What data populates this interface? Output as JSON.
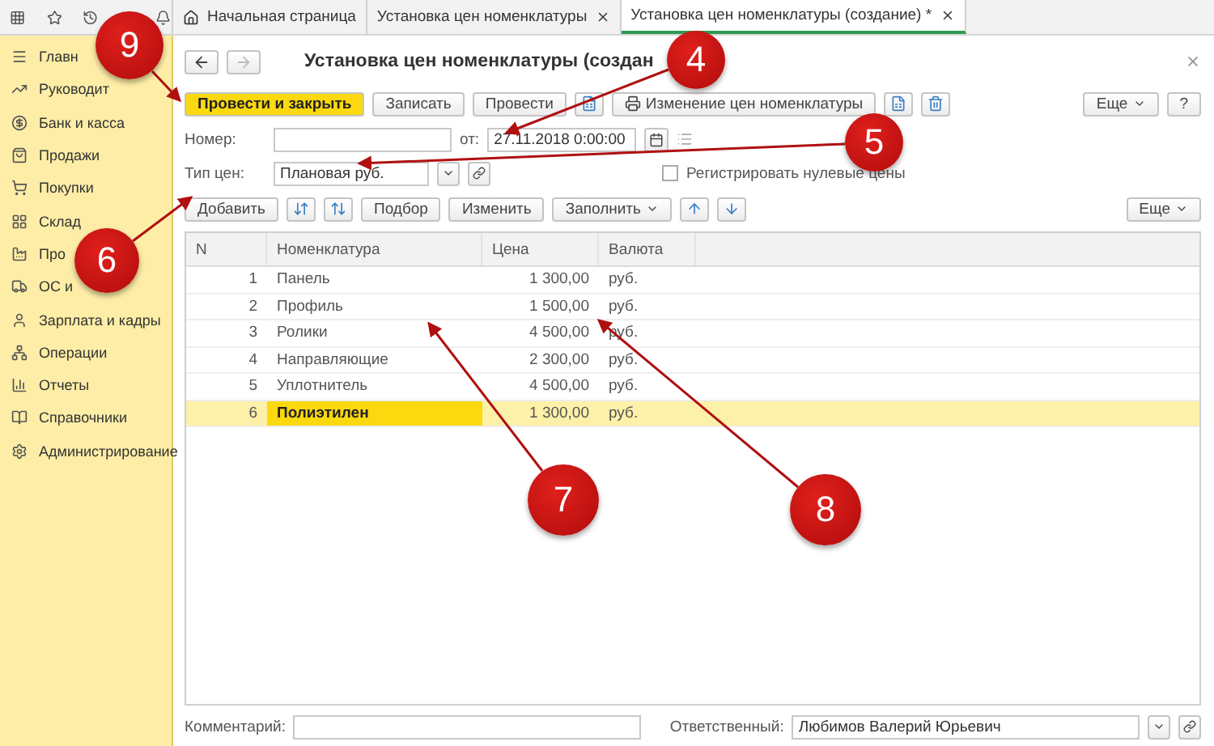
{
  "tabs": [
    {
      "kind": "home",
      "label": "Начальная страница",
      "selected": false
    },
    {
      "kind": "doc",
      "label": "Установка цен номенклатуры",
      "selected": false
    },
    {
      "kind": "doc",
      "label": "Установка цен номенклатуры (создание) *",
      "selected": true
    }
  ],
  "sidebar": {
    "items": [
      {
        "label": "Главн"
      },
      {
        "label": "Руководит"
      },
      {
        "label": "Банк и касса"
      },
      {
        "label": "Продажи"
      },
      {
        "label": "Покупки"
      },
      {
        "label": "Склад"
      },
      {
        "label": "Про"
      },
      {
        "label": "ОС и"
      },
      {
        "label": "Зарплата и кадры"
      },
      {
        "label": "Операции"
      },
      {
        "label": "Отчеты"
      },
      {
        "label": "Справочники"
      },
      {
        "label": "Администрирование"
      }
    ]
  },
  "form": {
    "title": "Установка цен номенклатуры (создан",
    "toolbar": [
      {
        "kind": "primary",
        "label": "Провести и закрыть"
      },
      {
        "kind": "button",
        "label": "Записать"
      },
      {
        "kind": "button",
        "label": "Провести"
      },
      {
        "kind": "icon"
      },
      {
        "kind": "print",
        "label": "Изменение цен номенклатуры"
      },
      {
        "kind": "icon"
      },
      {
        "kind": "icon"
      }
    ],
    "toolbar_right": [
      {
        "kind": "menu",
        "label": "Еще"
      },
      {
        "kind": "button",
        "label": "?"
      }
    ],
    "number": {
      "label": "Номер:"
    },
    "date": {
      "label": "от:",
      "value": "27.11.2018  0:00:00"
    },
    "price_type": {
      "label": "Тип цен:",
      "value": "Плановая руб."
    },
    "zero_prices": {
      "label": "Регистрировать нулевые цены",
      "checked": false
    },
    "table_toolbar": [
      {
        "kind": "button",
        "label": "Добавить"
      },
      {
        "kind": "icon"
      },
      {
        "kind": "icon"
      },
      {
        "kind": "button",
        "label": "Подбор"
      },
      {
        "kind": "button",
        "label": "Изменить"
      },
      {
        "kind": "menu",
        "label": "Заполнить"
      },
      {
        "kind": "icon"
      },
      {
        "kind": "icon"
      }
    ],
    "table_toolbar_right": [
      {
        "kind": "menu",
        "label": "Еще"
      }
    ],
    "table": {
      "columns": [
        "N",
        "Номенклатура",
        "Цена",
        "Валюта"
      ],
      "rows": [
        {
          "cells": [
            "1",
            "Панель",
            "1 300,00",
            "руб."
          ],
          "selected": false
        },
        {
          "cells": [
            "2",
            "Профиль",
            "1 500,00",
            "руб."
          ],
          "selected": false
        },
        {
          "cells": [
            "3",
            "Ролики",
            "4 500,00",
            "руб."
          ],
          "selected": false
        },
        {
          "cells": [
            "4",
            "Направляющие",
            "2 300,00",
            "руб."
          ],
          "selected": false
        },
        {
          "cells": [
            "5",
            "Уплотнитель",
            "4 500,00",
            "руб."
          ],
          "selected": false
        },
        {
          "cells": [
            "6",
            "Полиэтилен",
            "1 300,00",
            "руб."
          ],
          "selected": true
        }
      ]
    },
    "comment": {
      "label": "Комментарий:"
    },
    "responsible": {
      "label": "Ответственный:",
      "value": "Любимов Валерий Юрьевич"
    }
  },
  "callouts": [
    {
      "number": "9"
    },
    {
      "number": "4"
    },
    {
      "number": "5"
    },
    {
      "number": "6"
    },
    {
      "number": "7"
    },
    {
      "number": "8"
    }
  ]
}
